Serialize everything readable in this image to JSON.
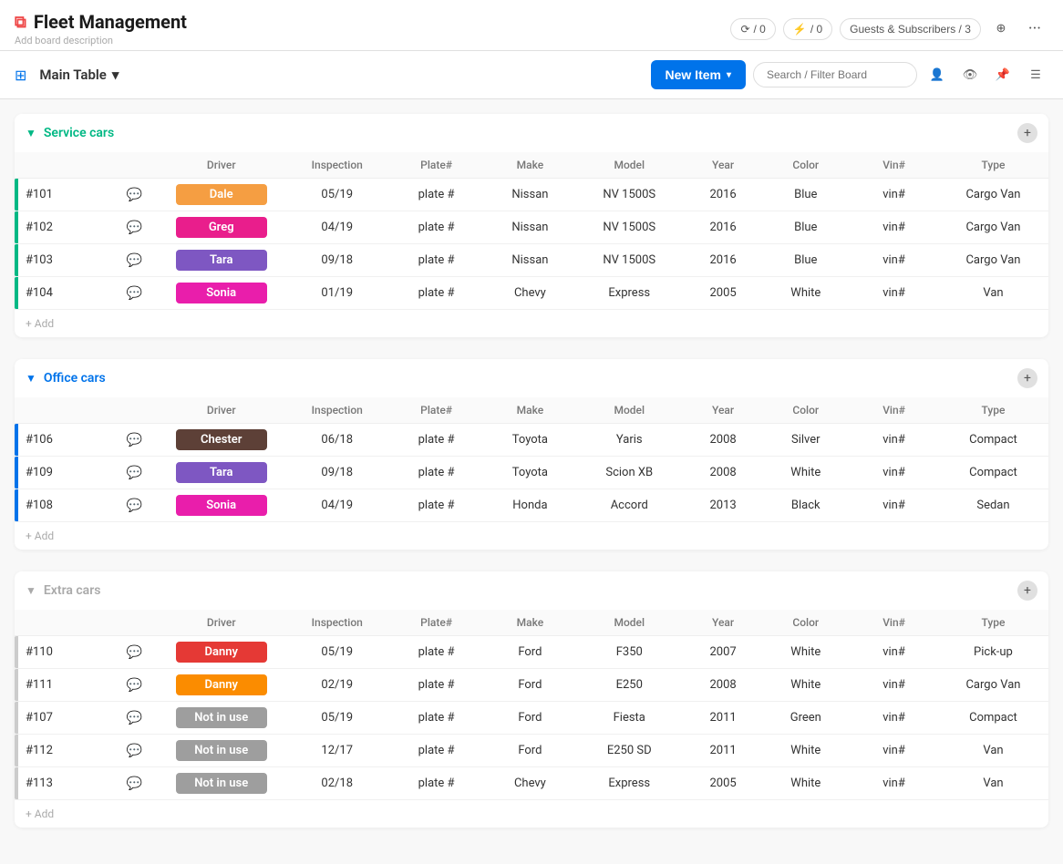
{
  "app": {
    "title": "Fleet Management",
    "board_desc": "Add board description"
  },
  "header": {
    "automation_label": "/ 0",
    "integration_label": "/ 0",
    "guests_label": "Guests & Subscribers / 3",
    "add_invite_icon": "⊕"
  },
  "toolbar": {
    "main_table_label": "Main Table",
    "new_item_label": "New Item",
    "search_placeholder": "Search / Filter Board"
  },
  "groups": [
    {
      "id": "service-cars",
      "title": "Service cars",
      "color_class": "green",
      "accent_class": "green-bar",
      "columns": [
        "Driver",
        "Inspection",
        "Plate#",
        "Make",
        "Model",
        "Year",
        "Color",
        "Vin#",
        "Type"
      ],
      "rows": [
        {
          "id": "#101",
          "driver": "Dale",
          "driver_class": "driver-orange",
          "inspection": "05/19",
          "plate": "plate #",
          "make": "Nissan",
          "model": "NV 1500S",
          "year": "2016",
          "color": "Blue",
          "vin": "vin#",
          "type": "Cargo Van"
        },
        {
          "id": "#102",
          "driver": "Greg",
          "driver_class": "driver-pink",
          "inspection": "04/19",
          "plate": "plate #",
          "make": "Nissan",
          "model": "NV 1500S",
          "year": "2016",
          "color": "Blue",
          "vin": "vin#",
          "type": "Cargo Van"
        },
        {
          "id": "#103",
          "driver": "Tara",
          "driver_class": "driver-purple",
          "inspection": "09/18",
          "plate": "plate #",
          "make": "Nissan",
          "model": "NV 1500S",
          "year": "2016",
          "color": "Blue",
          "vin": "vin#",
          "type": "Cargo Van"
        },
        {
          "id": "#104",
          "driver": "Sonia",
          "driver_class": "driver-magenta",
          "inspection": "01/19",
          "plate": "plate #",
          "make": "Chevy",
          "model": "Express",
          "year": "2005",
          "color": "White",
          "vin": "vin#",
          "type": "Van"
        }
      ],
      "add_label": "+ Add"
    },
    {
      "id": "office-cars",
      "title": "Office cars",
      "color_class": "blue",
      "accent_class": "blue-bar",
      "columns": [
        "Driver",
        "Inspection",
        "Plate#",
        "Make",
        "Model",
        "Year",
        "Color",
        "Vin#",
        "Type"
      ],
      "rows": [
        {
          "id": "#106",
          "driver": "Chester",
          "driver_class": "driver-brown",
          "inspection": "06/18",
          "plate": "plate #",
          "make": "Toyota",
          "model": "Yaris",
          "year": "2008",
          "color": "Silver",
          "vin": "vin#",
          "type": "Compact"
        },
        {
          "id": "#109",
          "driver": "Tara",
          "driver_class": "driver-purple2",
          "inspection": "09/18",
          "plate": "plate #",
          "make": "Toyota",
          "model": "Scion XB",
          "year": "2008",
          "color": "White",
          "vin": "vin#",
          "type": "Compact"
        },
        {
          "id": "#108",
          "driver": "Sonia",
          "driver_class": "driver-sonia2",
          "inspection": "04/19",
          "plate": "plate #",
          "make": "Honda",
          "model": "Accord",
          "year": "2013",
          "color": "Black",
          "vin": "vin#",
          "type": "Sedan"
        }
      ],
      "add_label": "+ Add"
    },
    {
      "id": "extra-cars",
      "title": "Extra cars",
      "color_class": "gray",
      "accent_class": "gray-bar",
      "columns": [
        "Driver",
        "Inspection",
        "Plate#",
        "Make",
        "Model",
        "Year",
        "Color",
        "Vin#",
        "Type"
      ],
      "rows": [
        {
          "id": "#110",
          "driver": "Danny",
          "driver_class": "driver-danny-red",
          "inspection": "05/19",
          "plate": "plate #",
          "make": "Ford",
          "model": "F350",
          "year": "2007",
          "color": "White",
          "vin": "vin#",
          "type": "Pick-up"
        },
        {
          "id": "#111",
          "driver": "Danny",
          "driver_class": "driver-danny-orange",
          "inspection": "02/19",
          "plate": "plate #",
          "make": "Ford",
          "model": "E250",
          "year": "2008",
          "color": "White",
          "vin": "vin#",
          "type": "Cargo Van"
        },
        {
          "id": "#107",
          "driver": "Not in use",
          "driver_class": "driver-gray",
          "inspection": "05/19",
          "plate": "plate #",
          "make": "Ford",
          "model": "Fiesta",
          "year": "2011",
          "color": "Green",
          "vin": "vin#",
          "type": "Compact"
        },
        {
          "id": "#112",
          "driver": "Not in use",
          "driver_class": "driver-gray",
          "inspection": "12/17",
          "plate": "plate #",
          "make": "Ford",
          "model": "E250 SD",
          "year": "2011",
          "color": "White",
          "vin": "vin#",
          "type": "Van"
        },
        {
          "id": "#113",
          "driver": "Not in use",
          "driver_class": "driver-gray",
          "inspection": "02/18",
          "plate": "plate #",
          "make": "Chevy",
          "model": "Express",
          "year": "2005",
          "color": "White",
          "vin": "vin#",
          "type": "Van"
        }
      ],
      "add_label": "+ Add"
    }
  ]
}
